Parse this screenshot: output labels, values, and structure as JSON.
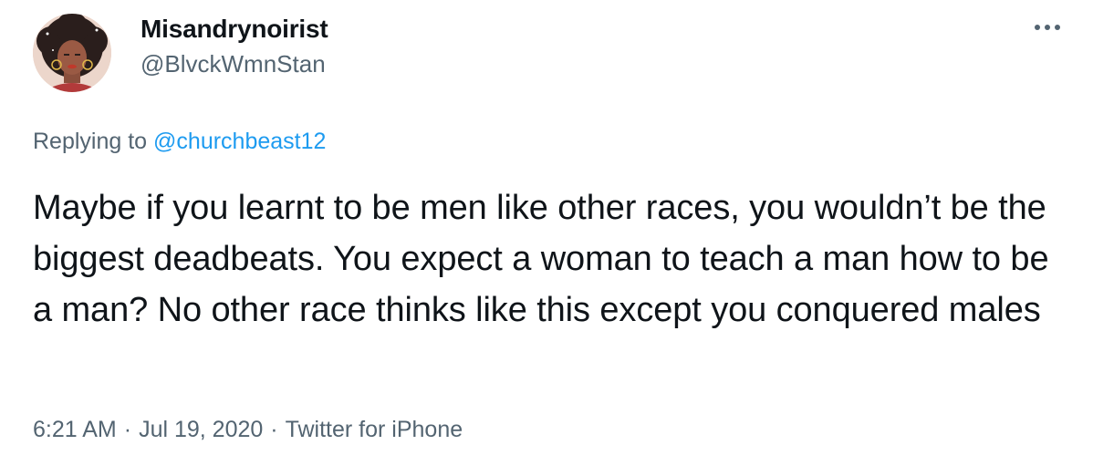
{
  "tweet": {
    "display_name": "Misandrynoirist",
    "handle": "@BlvckWmnStan",
    "more_icon": "more-horizontal-icon",
    "replying_prefix": "Replying to",
    "replying_to": "@churchbeast12",
    "text": "Maybe if you learnt to be men like other races, you wouldn’t be the biggest deadbeats. You expect a woman to teach a man how to be a man? No other race thinks like this except you conquered males",
    "time": "6:21 AM",
    "separator": "·",
    "date": "Jul 19, 2020",
    "source": "Twitter for iPhone"
  },
  "colors": {
    "primary_text": "#0f1419",
    "secondary_text": "#536471",
    "link": "#1d9bf0"
  }
}
